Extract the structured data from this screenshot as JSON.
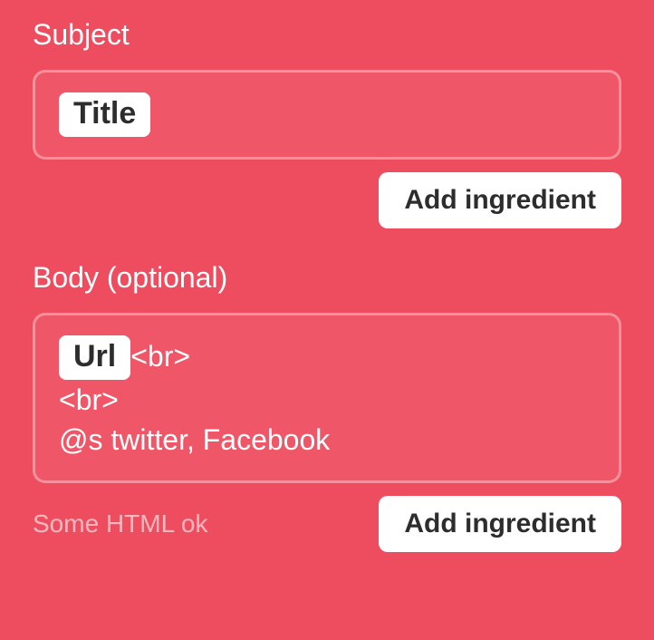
{
  "subject": {
    "label": "Subject",
    "ingredient": "Title",
    "add_button": "Add ingredient"
  },
  "body": {
    "label": "Body (optional)",
    "ingredient": "Url",
    "text_after_ingredient": "<br>",
    "line2": "<br>",
    "line3": "@s twitter, Facebook",
    "hint": "Some HTML ok",
    "add_button": "Add ingredient"
  }
}
